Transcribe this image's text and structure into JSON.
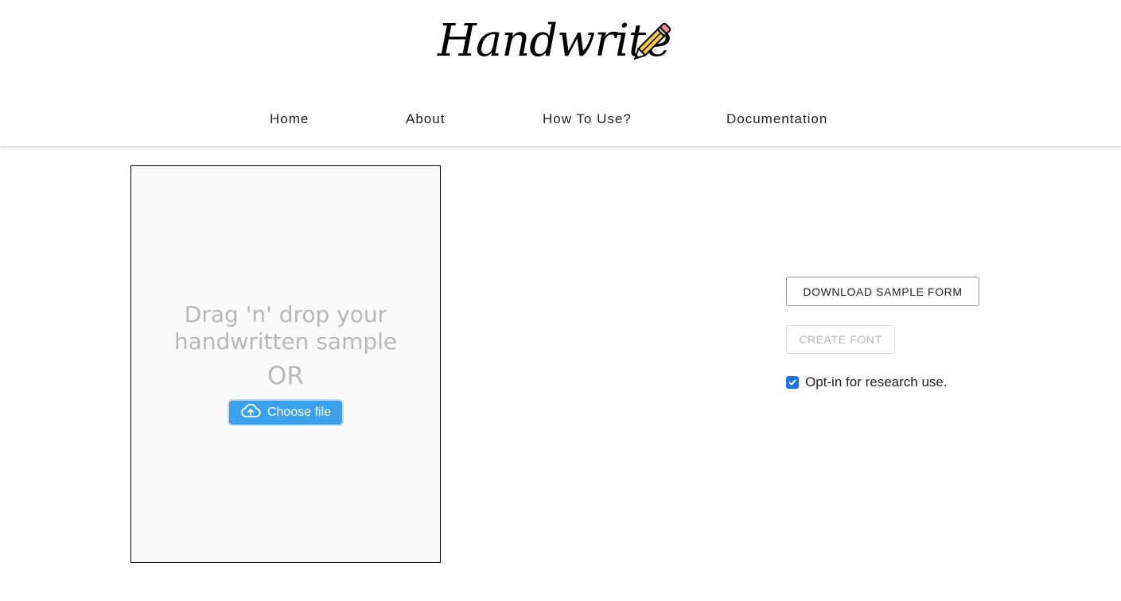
{
  "header": {
    "logo_text": "Handwrite",
    "nav": [
      {
        "label": "Home"
      },
      {
        "label": "About"
      },
      {
        "label": "How To Use?"
      },
      {
        "label": "Documentation"
      }
    ]
  },
  "dropzone": {
    "line1": "Drag 'n' drop your",
    "line2": "handwritten sample",
    "or": "OR",
    "button_label": "Choose file"
  },
  "actions": {
    "download_label": "DOWNLOAD SAMPLE FORM",
    "create_label": "CREATE FONT",
    "create_enabled": false,
    "optin_label": "Opt-in for research use.",
    "optin_checked": true
  },
  "colors": {
    "accent": "#3ba1ea",
    "checkbox": "#1a73e8",
    "placeholder_text": "#b8b8b8"
  },
  "icons": [
    "pencil-icon",
    "cloud-upload-icon",
    "checkmark-icon"
  ]
}
